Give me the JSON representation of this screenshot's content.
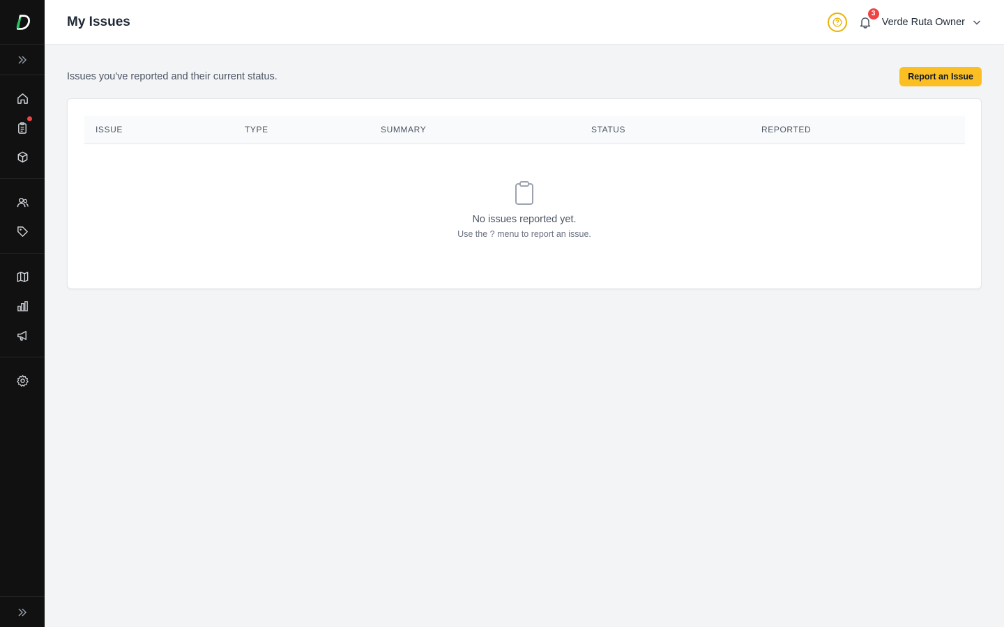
{
  "header": {
    "title": "My Issues",
    "notifications_count": "3",
    "user_name": "Verde Ruta Owner"
  },
  "sidebar": {
    "groups": [
      [
        "home-icon",
        "clipboard-list-icon",
        "box-icon"
      ],
      [
        "users-icon",
        "tag-icon"
      ],
      [
        "map-icon",
        "bar-chart-icon",
        "megaphone-icon"
      ],
      [
        "gear-icon"
      ]
    ],
    "orders_has_alert": true
  },
  "main": {
    "intro": "Issues you've reported and their current status.",
    "report_button": "Report an Issue",
    "table": {
      "columns": [
        "ISSUE",
        "TYPE",
        "SUMMARY",
        "STATUS",
        "REPORTED"
      ]
    },
    "empty": {
      "title": "No issues reported yet.",
      "subtitle": "Use the ? menu to report an issue."
    }
  },
  "colors": {
    "accent": "#fbbf24",
    "help_ring": "#eab308",
    "badge": "#ef4444",
    "sidebar_bg": "#111111",
    "logo_green": "#22c55e"
  }
}
